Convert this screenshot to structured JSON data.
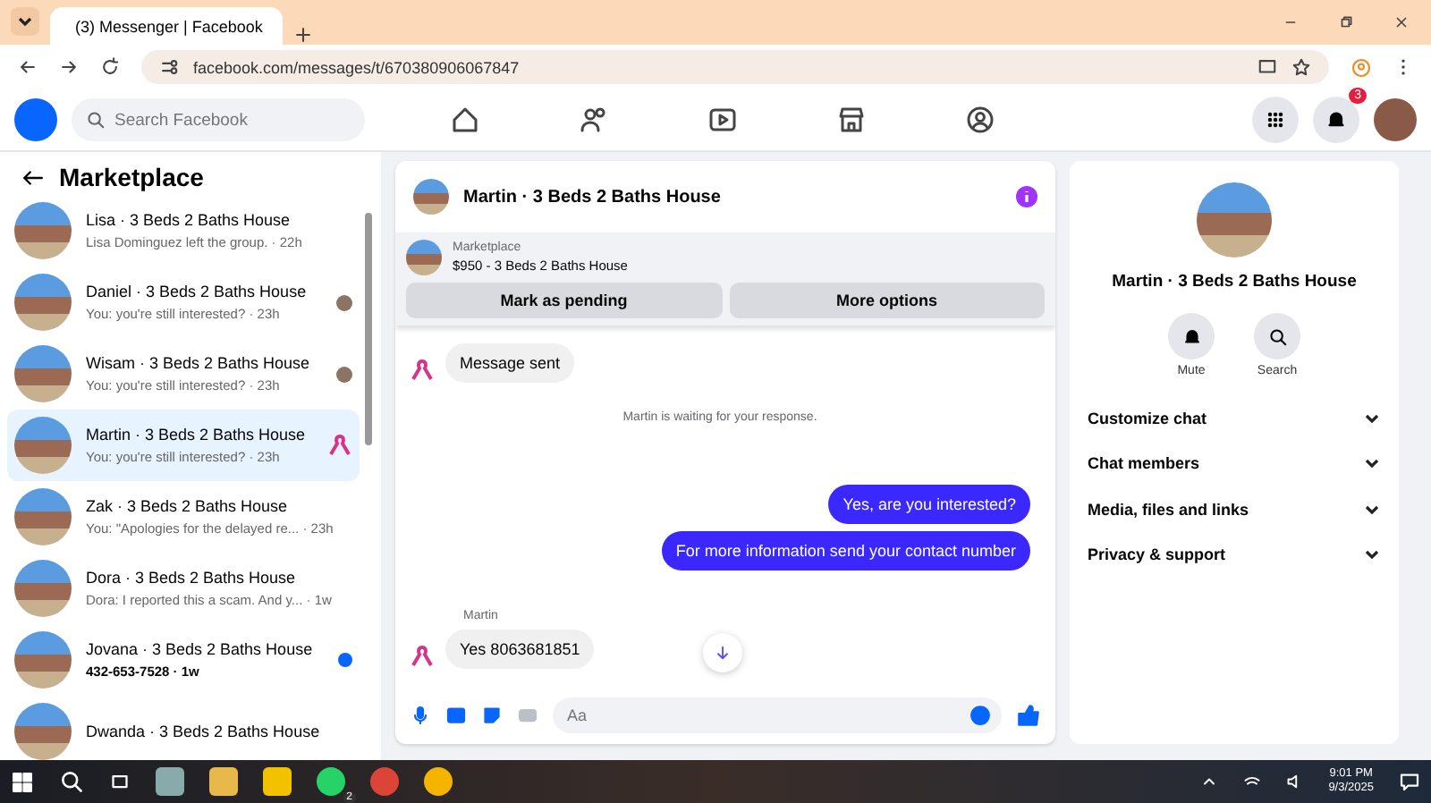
{
  "browser": {
    "tab_title": "(3) Messenger | Facebook",
    "url": "facebook.com/messages/t/670380906067847"
  },
  "header": {
    "search_placeholder": "Search Facebook",
    "notification_count": "3"
  },
  "sidebar": {
    "title": "Marketplace",
    "conversations": [
      {
        "kind": "plain",
        "name": "Lisa · 3 Beds 2 Baths House",
        "preview": "Lisa Dominguez left the group. · 22h",
        "selected": false
      },
      {
        "kind": "seen",
        "name": "Daniel · 3 Beds 2 Baths House",
        "preview": "You: you're still interested? · 23h",
        "selected": false
      },
      {
        "kind": "seen",
        "name": "Wisam · 3 Beds 2 Baths House",
        "preview": "You: you're still interested? · 23h",
        "selected": false
      },
      {
        "kind": "delivered",
        "name": "Martin · 3 Beds 2 Baths House",
        "preview": "You: you're still interested? · 23h",
        "selected": true
      },
      {
        "kind": "plain",
        "name": "Zak · 3 Beds 2 Baths House",
        "preview": "You: \"Apologies for the delayed re... · 23h",
        "selected": false
      },
      {
        "kind": "plain",
        "name": "Dora · 3 Beds 2 Baths House",
        "preview": "Dora: I reported this a scam. And y... · 1w",
        "selected": false
      },
      {
        "kind": "unread",
        "name": "Jovana · 3 Beds 2 Baths House",
        "preview": "432-653-7528 · 1w",
        "selected": false
      },
      {
        "kind": "plain",
        "name": "Dwanda · 3 Beds 2 Baths House",
        "selected": false
      }
    ]
  },
  "chat": {
    "title": "Martin · 3 Beds 2 Baths House",
    "listing": {
      "source": "Marketplace",
      "title": "$950 - 3 Beds 2 Baths House"
    },
    "actions": [
      "Mark as pending",
      "More options"
    ],
    "messages": [
      {
        "kind": "incoming",
        "text": "Message sent"
      },
      {
        "kind": "notice",
        "text": "Martin is waiting for your response."
      },
      {
        "kind": "outgoing",
        "text": "Yes, are you interested?"
      },
      {
        "kind": "outgoing",
        "text": "For more information send your contact number"
      },
      {
        "kind": "incoming",
        "sender": "Martin",
        "text": "Yes 8063681851"
      }
    ],
    "composer_placeholder": "Aa"
  },
  "details": {
    "title": "Martin · 3 Beds 2 Baths House",
    "actions": [
      "Mute",
      "Search"
    ],
    "sections": [
      "Customize chat",
      "Chat members",
      "Media, files and links",
      "Privacy & support"
    ]
  },
  "taskbar": {
    "whatsapp_badge": "2",
    "time": "9:01 PM",
    "date": "9/3/2025"
  }
}
